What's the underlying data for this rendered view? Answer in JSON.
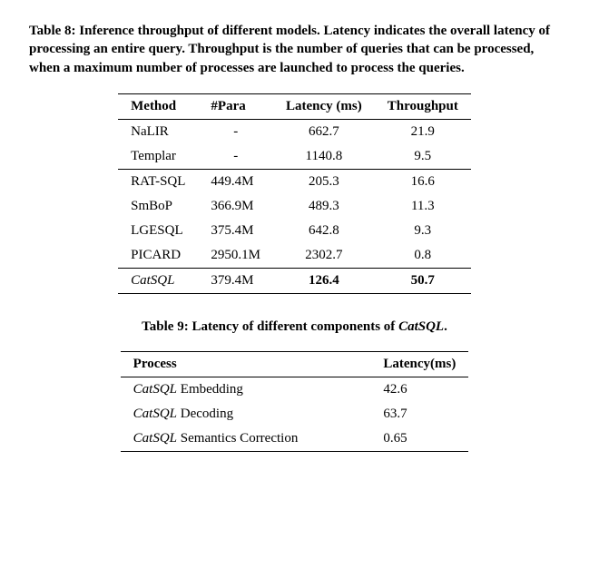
{
  "table8": {
    "caption": "Table 8: Inference throughput of different models. Latency indicates the overall latency of processing an entire query. Throughput is the number of queries that can be processed, when a maximum number of processes are launched to process the queries.",
    "headers": {
      "method": "Method",
      "para": "#Para",
      "latency": "Latency (ms)",
      "throughput": "Throughput"
    },
    "group1": [
      {
        "method": "NaLIR",
        "para": "-",
        "latency": "662.7",
        "throughput": "21.9"
      },
      {
        "method": "Templar",
        "para": "-",
        "latency": "1140.8",
        "throughput": "9.5"
      }
    ],
    "group2": [
      {
        "method": "RAT-SQL",
        "para": "449.4M",
        "latency": "205.3",
        "throughput": "16.6"
      },
      {
        "method": "SmBoP",
        "para": "366.9M",
        "latency": "489.3",
        "throughput": "11.3"
      },
      {
        "method": "LGESQL",
        "para": "375.4M",
        "latency": "642.8",
        "throughput": "9.3"
      },
      {
        "method": "PICARD",
        "para": "2950.1M",
        "latency": "2302.7",
        "throughput": "0.8"
      }
    ],
    "highlight": {
      "method": "CatSQL",
      "para": "379.4M",
      "latency": "126.4",
      "throughput": "50.7"
    }
  },
  "table9": {
    "caption_prefix": "Table 9: Latency of different components of ",
    "caption_em": "CatSQL",
    "caption_suffix": ".",
    "headers": {
      "process": "Process",
      "latency": "Latency(ms)"
    },
    "rows": [
      {
        "prefix": "CatSQL",
        "rest": " Embedding",
        "latency": "42.6"
      },
      {
        "prefix": "CatSQL",
        "rest": " Decoding",
        "latency": "63.7"
      },
      {
        "prefix": "CatSQL",
        "rest": " Semantics Correction",
        "latency": "0.65"
      }
    ]
  },
  "chart_data": [
    {
      "type": "table",
      "title": "Inference throughput of different models",
      "columns": [
        "Method",
        "#Para",
        "Latency (ms)",
        "Throughput"
      ],
      "rows": [
        [
          "NaLIR",
          null,
          662.7,
          21.9
        ],
        [
          "Templar",
          null,
          1140.8,
          9.5
        ],
        [
          "RAT-SQL",
          "449.4M",
          205.3,
          16.6
        ],
        [
          "SmBoP",
          "366.9M",
          489.3,
          11.3
        ],
        [
          "LGESQL",
          "375.4M",
          642.8,
          9.3
        ],
        [
          "PICARD",
          "2950.1M",
          2302.7,
          0.8
        ],
        [
          "CatSQL",
          "379.4M",
          126.4,
          50.7
        ]
      ]
    },
    {
      "type": "table",
      "title": "Latency of different components of CatSQL",
      "columns": [
        "Process",
        "Latency(ms)"
      ],
      "rows": [
        [
          "CatSQL Embedding",
          42.6
        ],
        [
          "CatSQL Decoding",
          63.7
        ],
        [
          "CatSQL Semantics Correction",
          0.65
        ]
      ]
    }
  ]
}
